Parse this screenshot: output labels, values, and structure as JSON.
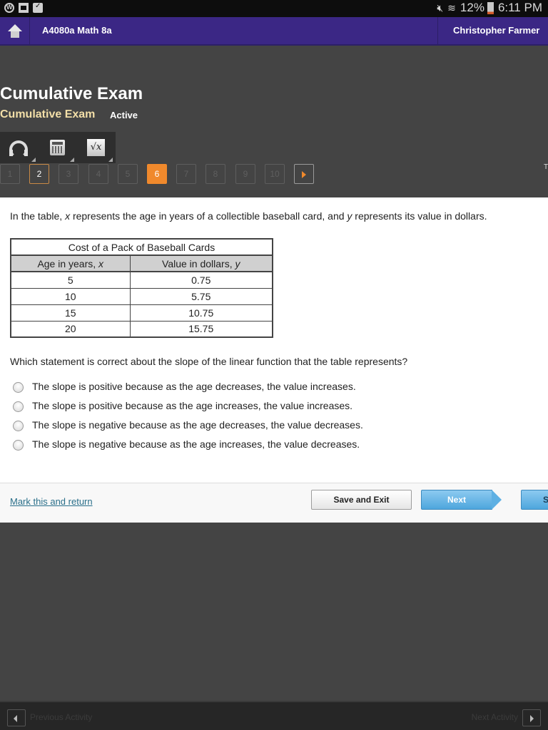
{
  "status_bar": {
    "battery": "12%",
    "time": "6:11 PM",
    "icons": [
      "app-globe-icon",
      "gallery-icon",
      "clipboard-icon",
      "mute-icon",
      "wifi-icon",
      "battery-icon"
    ]
  },
  "nav": {
    "course_title": "A4080a Math 8a",
    "user_name": "Christopher Farmer"
  },
  "header": {
    "title": "Cumulative Exam",
    "subtitle": "Cumulative Exam",
    "status": "Active"
  },
  "tools": [
    "headphones-icon",
    "calculator-icon",
    "formula-sheet-icon"
  ],
  "question_nav": {
    "items": [
      {
        "label": "1",
        "state": "unvisited"
      },
      {
        "label": "2",
        "state": "visited"
      },
      {
        "label": "3",
        "state": "unvisited"
      },
      {
        "label": "4",
        "state": "unvisited"
      },
      {
        "label": "5",
        "state": "unvisited"
      },
      {
        "label": "6",
        "state": "current"
      },
      {
        "label": "7",
        "state": "unvisited"
      },
      {
        "label": "8",
        "state": "unvisited"
      },
      {
        "label": "9",
        "state": "unvisited"
      },
      {
        "label": "10",
        "state": "unvisited"
      }
    ],
    "clipped_label": "T"
  },
  "question": {
    "intro_parts": [
      "In the table, ",
      "x",
      " represents the age in years of a collectible baseball card, and ",
      "y",
      " represents its value in dollars."
    ],
    "table": {
      "title": "Cost of a Pack of Baseball Cards",
      "headers": [
        {
          "text": "Age in years, ",
          "var": "x"
        },
        {
          "text": "Value in dollars, ",
          "var": "y"
        }
      ],
      "rows": [
        [
          "5",
          "0.75"
        ],
        [
          "10",
          "5.75"
        ],
        [
          "15",
          "10.75"
        ],
        [
          "20",
          "15.75"
        ]
      ]
    },
    "prompt": "Which statement is correct about the slope of the linear function that the table represents?",
    "choices": [
      "The slope is positive because as the age decreases, the value increases.",
      "The slope is positive because as the age increases, the value increases.",
      "The slope is negative because as the age decreases, the value decreases.",
      "The slope is negative because as the age increases, the value decreases."
    ]
  },
  "actions": {
    "mark_return": "Mark this and return",
    "save_exit": "Save and Exit",
    "next": "Next",
    "submit_clipped": "S"
  },
  "activity_bar": {
    "previous": "Previous Activity",
    "next": "Next Activity"
  }
}
